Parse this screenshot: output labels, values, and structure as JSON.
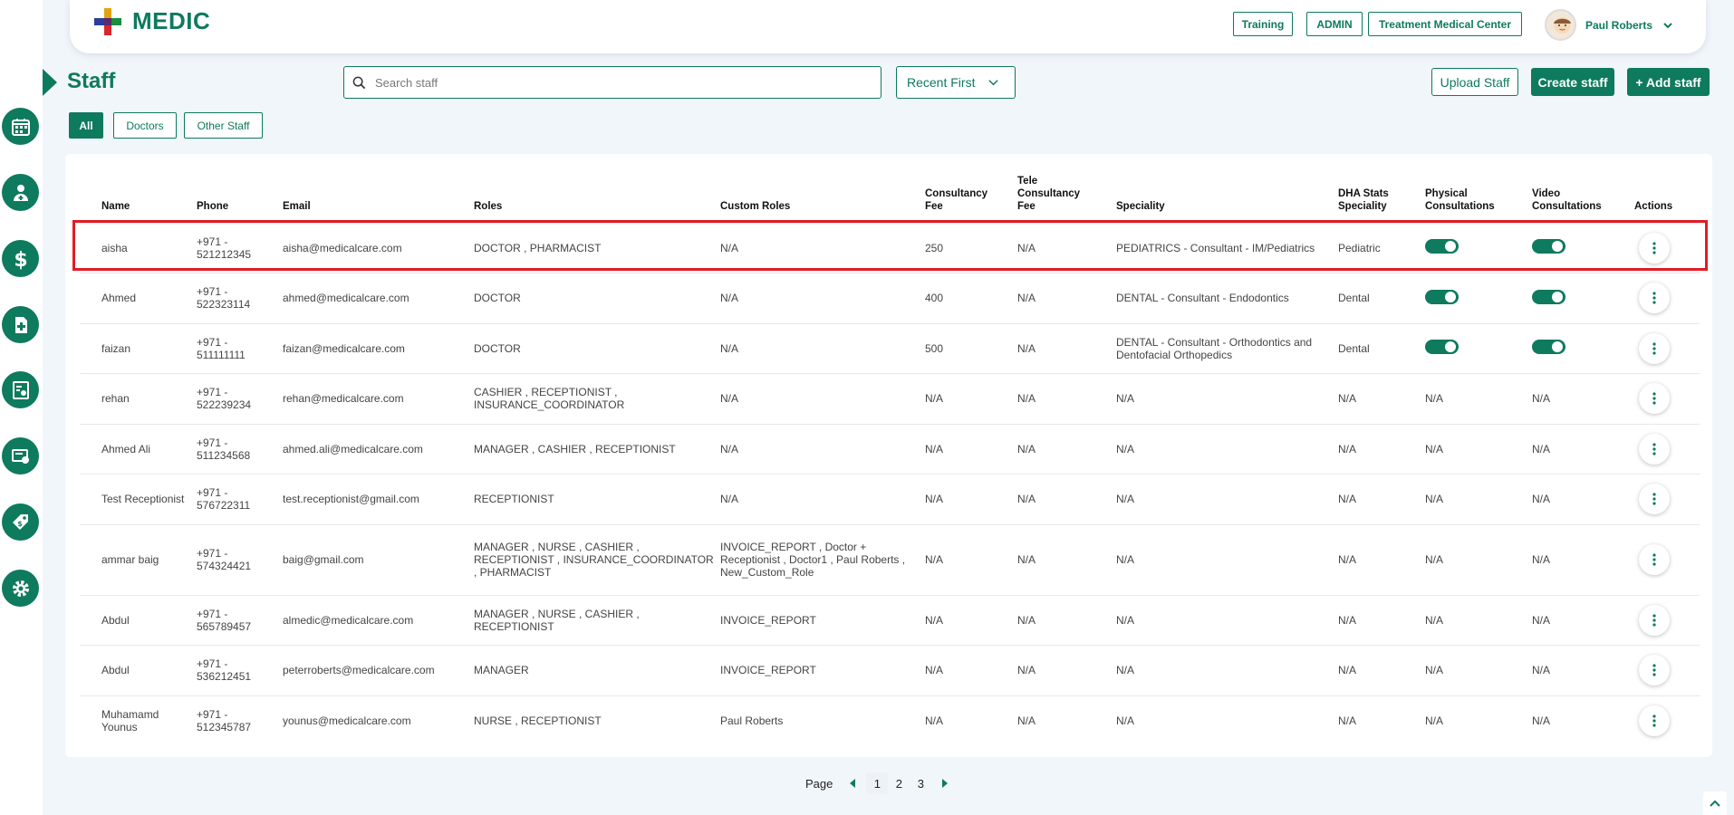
{
  "app": {
    "logo_text": "MEDIC",
    "colors": {
      "primary": "#0e7a5e",
      "highlight": "#e21b24",
      "background": "#f1f6fb"
    }
  },
  "sidebar": {
    "items": [
      {
        "icon": "calendar-icon"
      },
      {
        "icon": "doctor-icon"
      },
      {
        "icon": "dollar-icon"
      },
      {
        "icon": "medical-file-icon"
      },
      {
        "icon": "report-icon"
      },
      {
        "icon": "billing-icon"
      },
      {
        "icon": "tag-icon"
      },
      {
        "icon": "gear-icon"
      }
    ]
  },
  "header": {
    "buttons": [
      "Training",
      "ADMIN",
      "Treatment Medical Center"
    ],
    "user_name": "Paul Roberts"
  },
  "page": {
    "title": "Staff",
    "search_placeholder": "Search staff",
    "sort_label": "Recent First",
    "upload_label": "Upload Staff",
    "create_label": "Create staff",
    "add_label": "+ Add staff",
    "filters": [
      "All",
      "Doctors",
      "Other Staff"
    ]
  },
  "table": {
    "headers": {
      "name": "Name",
      "phone": "Phone",
      "email": "Email",
      "roles": "Roles",
      "custom_roles": "Custom Roles",
      "fee_1": "Consultancy",
      "fee_2": "Fee",
      "tele_1": "Tele",
      "tele_2": "Consultancy",
      "tele_3": "Fee",
      "speciality": "Speciality",
      "dha_1": "DHA Stats",
      "dha_2": "Speciality",
      "physical_1": "Physical",
      "physical_2": "Consultations",
      "video_1": "Video",
      "video_2": "Consultations",
      "actions": "Actions"
    },
    "rows": [
      {
        "name": "aisha",
        "phone": "+971 - 521212345",
        "email": "aisha@medicalcare.com",
        "roles": "DOCTOR , PHARMACIST",
        "custom_roles": "N/A",
        "fee": "250",
        "tele_fee": "N/A",
        "speciality": "PEDIATRICS - Consultant - IM/Pediatrics",
        "dha": "Pediatric",
        "physical": "",
        "video": ""
      },
      {
        "name": "Ahmed",
        "phone": "+971 - 522323114",
        "email": "ahmed@medicalcare.com",
        "roles": "DOCTOR",
        "custom_roles": "N/A",
        "fee": "400",
        "tele_fee": "N/A",
        "speciality": "DENTAL - Consultant - Endodontics",
        "dha": "Dental",
        "physical": "",
        "video": ""
      },
      {
        "name": "faizan",
        "phone": "+971 - 511111111",
        "email": "faizan@medicalcare.com",
        "roles": "DOCTOR",
        "custom_roles": "N/A",
        "fee": "500",
        "tele_fee": "N/A",
        "speciality": "DENTAL - Consultant - Orthodontics and Dentofacial Orthopedics",
        "dha": "Dental",
        "physical": "",
        "video": ""
      },
      {
        "name": "rehan",
        "phone": "+971 - 522239234",
        "email": "rehan@medicalcare.com",
        "roles": "CASHIER , RECEPTIONIST , INSURANCE_COORDINATOR",
        "custom_roles": "N/A",
        "fee": "N/A",
        "tele_fee": "N/A",
        "speciality": "N/A",
        "dha": "N/A",
        "physical": "N/A",
        "video": "N/A"
      },
      {
        "name": "Ahmed Ali",
        "phone": "+971 - 511234568",
        "email": "ahmed.ali@medicalcare.com",
        "roles": "MANAGER , CASHIER , RECEPTIONIST",
        "custom_roles": "N/A",
        "fee": "N/A",
        "tele_fee": "N/A",
        "speciality": "N/A",
        "dha": "N/A",
        "physical": "N/A",
        "video": "N/A"
      },
      {
        "name": "Test Receptionist",
        "phone": "+971 - 576722311",
        "email": "test.receptionist@gmail.com",
        "roles": "RECEPTIONIST",
        "custom_roles": "N/A",
        "fee": "N/A",
        "tele_fee": "N/A",
        "speciality": "N/A",
        "dha": "N/A",
        "physical": "N/A",
        "video": "N/A"
      },
      {
        "name": "ammar baig",
        "phone": "+971 - 574324421",
        "email": "baig@gmail.com",
        "roles": "MANAGER , NURSE , CASHIER , RECEPTIONIST , INSURANCE_COORDINATOR , PHARMACIST",
        "custom_roles": "INVOICE_REPORT , Doctor + Receptionist , Doctor1 , Paul Roberts , New_Custom_Role",
        "fee": "N/A",
        "tele_fee": "N/A",
        "speciality": "N/A",
        "dha": "N/A",
        "physical": "N/A",
        "video": "N/A"
      },
      {
        "name": "Abdul",
        "phone": "+971 - 565789457",
        "email": "almedic@medicalcare.com",
        "roles": "MANAGER , NURSE , CASHIER , RECEPTIONIST",
        "custom_roles": "INVOICE_REPORT",
        "fee": "N/A",
        "tele_fee": "N/A",
        "speciality": "N/A",
        "dha": "N/A",
        "physical": "N/A",
        "video": "N/A"
      },
      {
        "name": "Abdul",
        "phone": "+971 - 536212451",
        "email": "peterroberts@medicalcare.com",
        "roles": "MANAGER",
        "custom_roles": "INVOICE_REPORT",
        "fee": "N/A",
        "tele_fee": "N/A",
        "speciality": "N/A",
        "dha": "N/A",
        "physical": "N/A",
        "video": "N/A"
      },
      {
        "name": "Muhamamd Younus",
        "phone": "+971 - 512345787",
        "email": "younus@medicalcare.com",
        "roles": "NURSE , RECEPTIONIST",
        "custom_roles": "Paul Roberts",
        "fee": "N/A",
        "tele_fee": "N/A",
        "speciality": "N/A",
        "dha": "N/A",
        "physical": "N/A",
        "video": "N/A"
      }
    ]
  },
  "pagination": {
    "label": "Page",
    "pages": [
      "1",
      "2",
      "3"
    ],
    "current": "1"
  }
}
